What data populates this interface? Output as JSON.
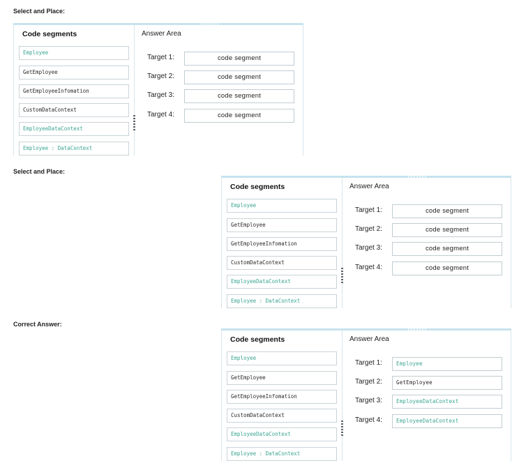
{
  "sections": [
    {
      "label": "Select and Place:",
      "left_title": "Code segments",
      "right_title": "Answer Area",
      "segments": [
        {
          "text": "Employee",
          "color": "green"
        },
        {
          "text": "GetEmployee",
          "color": "dark"
        },
        {
          "text": "GetEmployeeInfomation",
          "color": "dark"
        },
        {
          "text": "CustomDataContext",
          "color": "dark"
        },
        {
          "text": "EmployeeDataContext",
          "color": "green"
        },
        {
          "text": "Employee : DataContext",
          "color": "green"
        }
      ],
      "targets": [
        {
          "label": "Target 1:",
          "value": "code segment",
          "filled": false
        },
        {
          "label": "Target 2:",
          "value": "code segment",
          "filled": false
        },
        {
          "label": "Target 3:",
          "value": "code segment",
          "filled": false
        },
        {
          "label": "Target 4:",
          "value": "code segment",
          "filled": false
        }
      ]
    },
    {
      "label": "Select and Place:",
      "left_title": "Code segments",
      "right_title": "Answer Area",
      "segments": [
        {
          "text": "Employee",
          "color": "green"
        },
        {
          "text": "GetEmployee",
          "color": "dark"
        },
        {
          "text": "GetEmployeeInfomation",
          "color": "dark"
        },
        {
          "text": "CustomDataContext",
          "color": "dark"
        },
        {
          "text": "EmployeeDataContext",
          "color": "green"
        },
        {
          "text": "Employee : DataContext",
          "color": "green"
        }
      ],
      "targets": [
        {
          "label": "Target 1:",
          "value": "code segment",
          "filled": false
        },
        {
          "label": "Target 2:",
          "value": "code segment",
          "filled": false
        },
        {
          "label": "Target 3:",
          "value": "code segment",
          "filled": false
        },
        {
          "label": "Target 4:",
          "value": "code segment",
          "filled": false
        }
      ]
    },
    {
      "label": "Correct Answer:",
      "left_title": "Code segments",
      "right_title": "Answer Area",
      "segments": [
        {
          "text": "Employee",
          "color": "green"
        },
        {
          "text": "GetEmployee",
          "color": "dark"
        },
        {
          "text": "GetEmployeeInfomation",
          "color": "dark"
        },
        {
          "text": "CustomDataContext",
          "color": "dark"
        },
        {
          "text": "EmployeeDataContext",
          "color": "green"
        },
        {
          "text": "Employee : DataContext",
          "color": "green"
        }
      ],
      "targets": [
        {
          "label": "Target 1:",
          "value": "Employee",
          "filled": true,
          "color": "green"
        },
        {
          "label": "Target 2:",
          "value": "GetEmployee",
          "filled": true,
          "color": "dark"
        },
        {
          "label": "Target 3:",
          "value": "EmployeeDataContext",
          "filled": true,
          "color": "green"
        },
        {
          "label": "Target 4:",
          "value": "EmployeeDataContext",
          "filled": true,
          "color": "green"
        }
      ]
    }
  ],
  "colors": {
    "green_code": "#3aa592",
    "dark_code": "#2a2a2a",
    "panel_accent": "#c7e3ee"
  }
}
